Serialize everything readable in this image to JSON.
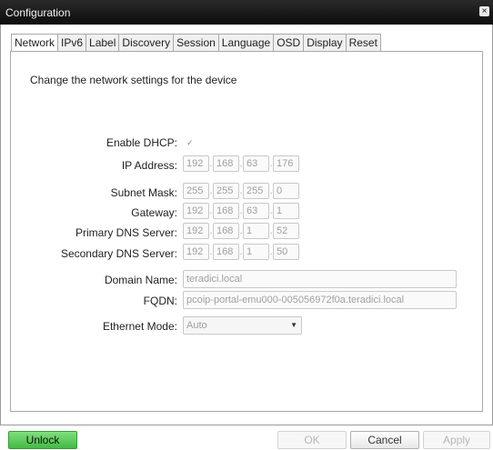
{
  "window": {
    "title": "Configuration",
    "close_glyph": "×"
  },
  "tabs": [
    {
      "label": "Network",
      "active": true
    },
    {
      "label": "IPv6"
    },
    {
      "label": "Label"
    },
    {
      "label": "Discovery"
    },
    {
      "label": "Session"
    },
    {
      "label": "Language"
    },
    {
      "label": "OSD"
    },
    {
      "label": "Display"
    },
    {
      "label": "Reset"
    }
  ],
  "network": {
    "description": "Change the network settings for the device",
    "enable_dhcp": {
      "label": "Enable DHCP:",
      "checked": true,
      "glyph": "✓"
    },
    "ip_address": {
      "label": "IP Address:",
      "octets": [
        "192",
        "168",
        "63",
        "176"
      ]
    },
    "subnet_mask": {
      "label": "Subnet Mask:",
      "octets": [
        "255",
        "255",
        "255",
        "0"
      ]
    },
    "gateway": {
      "label": "Gateway:",
      "octets": [
        "192",
        "168",
        "63",
        "1"
      ]
    },
    "primary_dns": {
      "label": "Primary DNS Server:",
      "octets": [
        "192",
        "168",
        "1",
        "52"
      ]
    },
    "secondary_dns": {
      "label": "Secondary DNS Server:",
      "octets": [
        "192",
        "168",
        "1",
        "50"
      ]
    },
    "domain_name": {
      "label": "Domain Name:",
      "value": "teradici.local"
    },
    "fqdn": {
      "label": "FQDN:",
      "value": "pcoip-portal-emu000-005056972f0a.teradici.local"
    },
    "ethernet_mode": {
      "label": "Ethernet Mode:",
      "value": "Auto",
      "arrow": "▼"
    }
  },
  "buttons": {
    "unlock": "Unlock",
    "ok": "OK",
    "cancel": "Cancel",
    "apply": "Apply"
  },
  "colors": {
    "unlock_green": "#44b944",
    "titlebar": "#111111"
  }
}
